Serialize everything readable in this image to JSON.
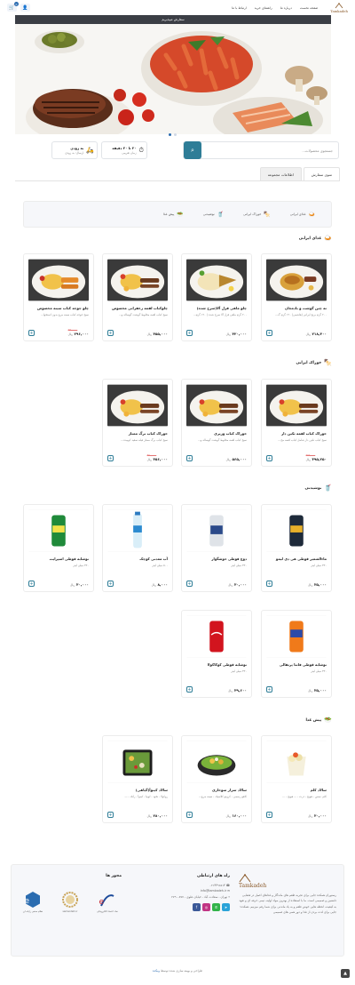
{
  "header": {
    "logo_text": "Tamkadeh",
    "nav": [
      "صفحه نخست",
      "درباره ما",
      "راهنمای خرید",
      "ارتباط با ما"
    ],
    "cart_count": "0",
    "cart_icon": "cart-icon",
    "user_icon": "user-icon"
  },
  "announcement": "سفارش میپذیریم",
  "hero": {
    "slides": 2,
    "active_slide": 2
  },
  "search": {
    "placeholder": "جستجوی محصولات..."
  },
  "delivery": {
    "time": {
      "title": "۲۰ تا ۲۰ دقیقه",
      "subtitle": "زمان تقریبی"
    },
    "cost": {
      "title": "به زودی",
      "subtitle": "ارسال: به زودی"
    }
  },
  "tabs": [
    "منوی سفارش",
    "اطلاعات مجموعه"
  ],
  "categories": [
    {
      "label": "غذای ایرانی",
      "icon": "rice-icon"
    },
    {
      "label": "خوراک ایرانی",
      "icon": "kebab-icon"
    },
    {
      "label": "نوشیدنی",
      "icon": "drink-icon"
    },
    {
      "label": "پیش غذا",
      "icon": "bowl-icon"
    }
  ],
  "currency": "ریال",
  "sections": [
    {
      "title": "غذای ایرانی",
      "icon": "rice-icon",
      "items": [
        {
          "name": "ته چین گوشت و بادمجان",
          "desc": "۲۰۰ گرم برنج ایرانی (هاشمی) ۱۲۰ گرم گ...",
          "old": "",
          "price": "۲۱۸,۴۰۰",
          "img": "food"
        },
        {
          "name": "چلو ماهی قزل آلا(سرخ شده)",
          "desc": "۲۰۰ گرم ماهی قزل آلا سرخ شده ( ۱۲۰ گرم...",
          "old": "",
          "price": "۴۲۰,۰۰۰",
          "img": "fish"
        },
        {
          "name": "چلوکباب لقمه زعفرانی مخصوص",
          "desc": "سیخ کباب لقمه مخلوط گوشت گوساله و...",
          "old": "",
          "price": "۴۵۵,۰۰۰",
          "img": "kebab"
        },
        {
          "name": "چلو جوجه کباب سینه مخصوص",
          "desc": "سیخ جوجه کباب سینه مرغ بدون استخوا...",
          "old": "۲۳۰,۰۰۰",
          "price": "۲۹۶,۰۰۰",
          "img": "chicken"
        }
      ]
    },
    {
      "title": "خوراک ایرانی",
      "icon": "kebab-icon",
      "items": [
        {
          "name": "خوراک کباب لقمه تکین دار",
          "desc": "سیخ کباب تکین دار شامل کباب لقمه مخ...",
          "old": "۳۹۸,۰۰۰",
          "price": "۳۹۵,۲۵۰",
          "img": "kebab"
        },
        {
          "name": "خوراک کباب وزیری",
          "desc": "سیخ کباب لقمه مخلوط گوشت گوساله و...",
          "old": "",
          "price": "۵۶۵,۰۰۰",
          "img": "kebab"
        },
        {
          "name": "خوراک کباب برگ ممتاز",
          "desc": "سیخ کباب برگ ممتاز فیله سفید کوبیده...",
          "old": "۴۷۰,۰۰۰",
          "price": "۴۵۶,۰۰۰",
          "img": "kebab"
        }
      ]
    },
    {
      "title": "نوشیدنی",
      "icon": "drink-icon",
      "items": [
        {
          "name": "ماءالشعیر قوطی هی دی لیمو",
          "desc": "۳۳۰ میلی لیتر",
          "old": "",
          "price": "۳۵,۰۰۰",
          "img": "can_dark"
        },
        {
          "name": "دوغ قوطی خوشگوار",
          "desc": "۳۳۰ میلی لیتر",
          "old": "",
          "price": "۳۰,۰۰۰",
          "img": "can_white"
        },
        {
          "name": "آب معدنی کوچک",
          "desc": "۵۰۰ میلی لیتر",
          "old": "",
          "price": "۸,۰۰۰",
          "img": "water"
        },
        {
          "name": "نوشابه قوطی اسپرایت",
          "desc": "۳۳۰ میلی لیتر",
          "old": "",
          "price": "۳۰,۰۰۰",
          "img": "can_green"
        },
        {
          "name": "نوشابه قوطی فانتا پرتقالی",
          "desc": "۳۳۰ میلی لیتر",
          "old": "",
          "price": "۳۵,۰۰۰",
          "img": "can_orange"
        },
        {
          "name": "نوشابه قوطی کوکاکولا",
          "desc": "۳۳۰ میلی لیتر",
          "old": "",
          "price": "۳۹,۶۰۰",
          "img": "can_red"
        }
      ]
    },
    {
      "title": "پیش غذا",
      "icon": "bowl-icon",
      "items": [
        {
          "name": "سالاد کلم",
          "desc": "کلم، سس ، هویج ، ذرت ، ... هویج ، ...",
          "old": "",
          "price": "۳۰,۰۰۰",
          "img": "salad_cup"
        },
        {
          "name": "سالاد سزار سوخاری",
          "desc": "کاهو رسمی ، کروتو کلاسیک ، سینه مرغ...",
          "old": "",
          "price": "۱۶۰,۰۰۰",
          "img": "salad_bowl"
        },
        {
          "name": "سالاد کینوآ(گیاهی)",
          "desc": "روکولا ، نخود ، لوبیا ، کینوآ ، رانک ، ...",
          "old": "",
          "price": "۲۸۰,۰۰۰",
          "img": "salad_box"
        }
      ]
    }
  ],
  "footer": {
    "about": {
      "logo_text": "Tamkadeh",
      "text": "رستوران همکده جایی برای تجربه طعم های ماندگار و غذاهای اصیل در فضایی دلنشین و صمیمی است. ما با استفاده از بهترین مواد اولیه، تیمی حرفه ای و تعهد به کیفیت، لحظه هایی خوش طعم و به یاد ماندنی برای شما رقم میزنیم. همکده؛ جایی برای لذت بردن از غذا و دور همی های صمیمی"
    },
    "contact": {
      "title": "راه های ارتباطی",
      "phone": "۰۲۱۴۴۹۶۵۱۴",
      "email": "info@tamkadeh.ir",
      "address": "تهران ، سعادت آباد ، خیابان علوی ، ۸۷۷ ، ۲۷۹",
      "socials": [
        "telegram-icon",
        "whatsapp-icon",
        "instagram-icon",
        "facebook-icon"
      ]
    },
    "licenses": {
      "title": "مجوز ها",
      "labels": [
        "نماد اعتماد الکترونیکی",
        "samandehi.ir",
        "نظام صنفی رایانه ای"
      ]
    }
  },
  "credits": {
    "text": "طراحی و بهینه سازی شده توسط",
    "brand": "وبکده"
  },
  "colors": {
    "accent": "#2e7d97",
    "brand": "#8a5a2a",
    "dark": "#3b3e45"
  }
}
